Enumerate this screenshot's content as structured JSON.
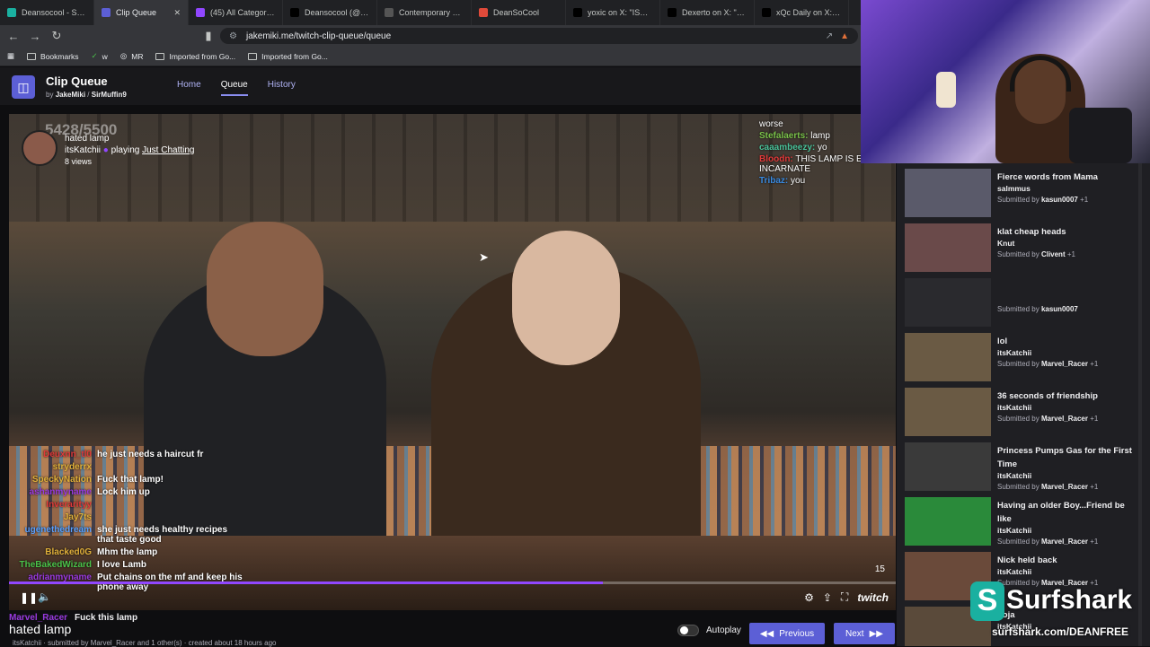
{
  "browser": {
    "tabs": [
      {
        "label": "Deansocool - Surfs",
        "fav_color": "#1ab0a0"
      },
      {
        "label": "Clip Queue",
        "fav_color": "#5c5fd6",
        "active": true
      },
      {
        "label": "(45) All Categories",
        "fav_color": "#9147ff"
      },
      {
        "label": "Deansocool (@Dea",
        "fav_color": "#000000"
      },
      {
        "label": "Contemporary Men",
        "fav_color": "#555555"
      },
      {
        "label": "DeanSoCool",
        "fav_color": "#e04a3a"
      },
      {
        "label": "yoxic on X: \"IShowS",
        "fav_color": "#000000"
      },
      {
        "label": "Dexerto on X: \"Stre",
        "fav_color": "#000000"
      },
      {
        "label": "xQc Daily on X: \"xQ",
        "fav_color": "#000000"
      }
    ],
    "url": "jakemiki.me/twitch-clip-queue/queue",
    "bookmarks": [
      "Bookmarks",
      "w",
      "MR",
      "Imported from Go...",
      "Imported from Go..."
    ]
  },
  "app": {
    "title": "Clip Queue",
    "by": "by",
    "author1": "JakeMiki",
    "separator": "/",
    "author2": "SirMuffin9",
    "nav": [
      "Home",
      "Queue",
      "History"
    ]
  },
  "player": {
    "counter": "5428/5500",
    "clip_title": "hated lamp",
    "channel": "itsKatchii",
    "playing": "playing",
    "category": "Just Chatting",
    "views": "8 views",
    "timer": "15",
    "progress_pct": 67,
    "brand": "twitch"
  },
  "chat_top": [
    {
      "name": "",
      "msg": "worse",
      "color": "#cccccc"
    },
    {
      "name": "Stefalaerts:",
      "msg": "lamp",
      "color": "#7ac24a"
    },
    {
      "name": "caaambeezy:",
      "msg": "yo",
      "color": "#4ac29a"
    },
    {
      "name": "Bloodn:",
      "msg": "THIS LAMP IS EVIL INCARNATE",
      "color": "#e03a3a"
    },
    {
      "name": "Tribaz:",
      "msg": "you",
      "color": "#3a8ae0"
    }
  ],
  "chat_left": [
    {
      "name": "Deuxnn_tl0",
      "msg": "he just needs a haircut fr",
      "color": "#e03a3a"
    },
    {
      "name": "stryderrx",
      "msg": "",
      "color": "#e0b03a"
    },
    {
      "name": "SpeckyNation",
      "msg": "Fuck that lamp!",
      "color": "#e0b03a"
    },
    {
      "name": "ashanmyname",
      "msg": "Lock him up",
      "color": "#9a3ae0"
    },
    {
      "name": "Inverarityy",
      "msg": "",
      "color": "#e03a3a"
    },
    {
      "name": "Jay7ts",
      "msg": "",
      "color": "#e0b03a"
    },
    {
      "name": "ugenethedream",
      "msg": "she just needs healthy recipes that taste good",
      "color": "#5aa0ff"
    },
    {
      "name": "Blacked0G",
      "msg": "Mhm the lamp",
      "color": "#e0b03a"
    },
    {
      "name": "TheBakedWizard",
      "msg": "I love Lamb",
      "color": "#4ac24a"
    },
    {
      "name": "adrianmyname",
      "msg": "Put chains on the mf and keep his phone away",
      "color": "#9a3ae0"
    }
  ],
  "bottom": {
    "chat_name": "Marvel_Racer",
    "chat_msg": "Fuck this lamp",
    "title": "hated lamp",
    "sub": "itsKatchii · submitted by Marvel_Racer and 1 other(s) · created about 18 hours ago",
    "autoplay": "Autoplay",
    "prev": "Previous",
    "next": "Next"
  },
  "queue": [
    {
      "title": "Fierce words from Mama",
      "channel": "salmmus",
      "submitted": "Submitted by",
      "by": "kasun0007",
      "extra": "+1",
      "thumb": "#5a5a6a"
    },
    {
      "title": "klat cheap heads",
      "channel": "Knut",
      "submitted": "Submitted by",
      "by": "Clivent",
      "extra": "+1",
      "thumb": "#6a4a4a"
    },
    {
      "title": "",
      "channel": "",
      "submitted": "Submitted by",
      "by": "kasun0007",
      "extra": "",
      "thumb": "#2a2a2e"
    },
    {
      "title": "lol",
      "channel": "itsKatchii",
      "submitted": "Submitted by",
      "by": "Marvel_Racer",
      "extra": "+1",
      "thumb": "#6a5a44"
    },
    {
      "title": "36 seconds of friendship",
      "channel": "itsKatchii",
      "submitted": "Submitted by",
      "by": "Marvel_Racer",
      "extra": "+1",
      "thumb": "#6a5a44"
    },
    {
      "title": "Princess Pumps Gas for the First Time",
      "channel": "itsKatchii",
      "submitted": "Submitted by",
      "by": "Marvel_Racer",
      "extra": "+1",
      "thumb": "#3a3a3a"
    },
    {
      "title": "Having an older Boy...Friend be like",
      "channel": "itsKatchii",
      "submitted": "Submitted by",
      "by": "Marvel_Racer",
      "extra": "+1",
      "thumb": "#2a8a3a"
    },
    {
      "title": "Nick held back",
      "channel": "itsKatchii",
      "submitted": "Submitted by",
      "by": "Marvel_Racer",
      "extra": "+1",
      "thumb": "#6a4a3a"
    },
    {
      "title": "doja",
      "channel": "itsKatchii",
      "submitted": "",
      "by": "",
      "extra": "",
      "thumb": "#5a4a3a"
    }
  ],
  "ad": {
    "brand": "Surfshark",
    "url": "surfshark.com/DEANFREE"
  }
}
